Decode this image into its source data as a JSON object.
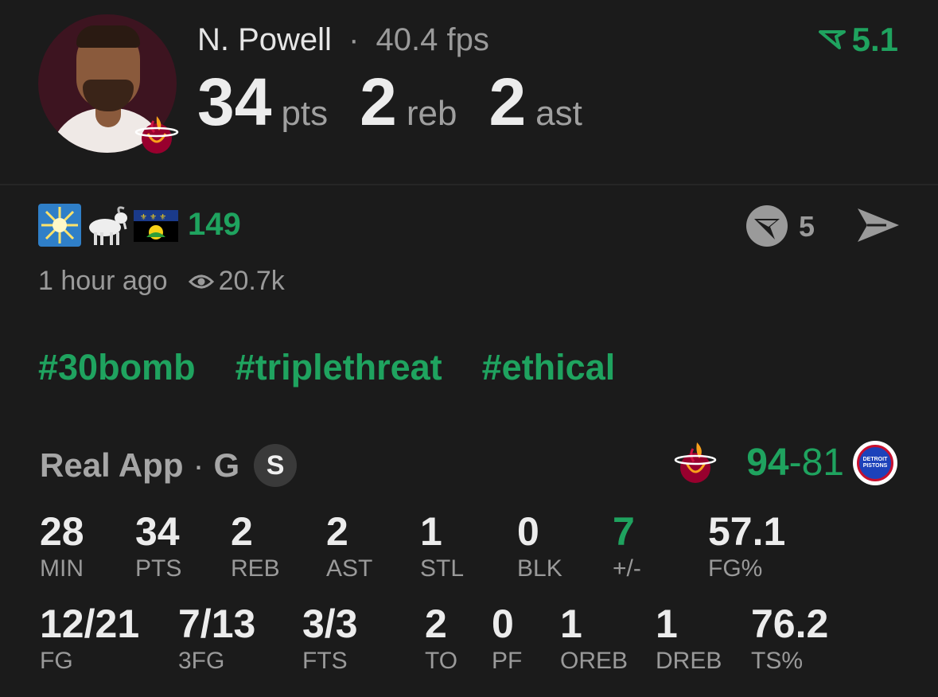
{
  "player": {
    "name": "N. Powell",
    "separator": "·",
    "fps": "40.4 fps",
    "points": "34",
    "points_unit": "pts",
    "rebounds": "2",
    "rebounds_unit": "reb",
    "assists": "2",
    "assists_unit": "ast",
    "rating": "5.1",
    "team": "Miami Heat"
  },
  "reactions": {
    "emojis": [
      "sparkle-burst",
      "goat",
      "guadeloupe-flag"
    ],
    "count": "149",
    "comments": "5"
  },
  "meta": {
    "time_ago": "1 hour ago",
    "views": "20.7k"
  },
  "tags": [
    "#30bomb",
    "#triplethreat",
    "#ethical"
  ],
  "game": {
    "source": "Real App",
    "separator": "·",
    "position": "G",
    "starter_badge": "S",
    "home_score": "94",
    "score_dash": "-",
    "away_score": "81",
    "opponent_logo_text": [
      "DETROIT",
      "PISTONS"
    ]
  },
  "stats_row1": [
    {
      "value": "28",
      "label": "MIN"
    },
    {
      "value": "34",
      "label": "PTS"
    },
    {
      "value": "2",
      "label": "REB"
    },
    {
      "value": "2",
      "label": "AST"
    },
    {
      "value": "1",
      "label": "STL"
    },
    {
      "value": "0",
      "label": "BLK"
    },
    {
      "value": "7",
      "label": "+/-"
    },
    {
      "value": "57.1",
      "label": "FG%"
    }
  ],
  "stats_row2": [
    {
      "value": "12/21",
      "label": "FG"
    },
    {
      "value": "7/13",
      "label": "3FG"
    },
    {
      "value": "3/3",
      "label": "FTS"
    },
    {
      "value": "2",
      "label": "TO"
    },
    {
      "value": "0",
      "label": "PF"
    },
    {
      "value": "1",
      "label": "OREB"
    },
    {
      "value": "1",
      "label": "DREB"
    },
    {
      "value": "76.2",
      "label": "TS%"
    }
  ],
  "colors": {
    "background": "#1b1b1b",
    "accent_green": "#1fa35f",
    "muted_text": "#9a9a9a"
  }
}
